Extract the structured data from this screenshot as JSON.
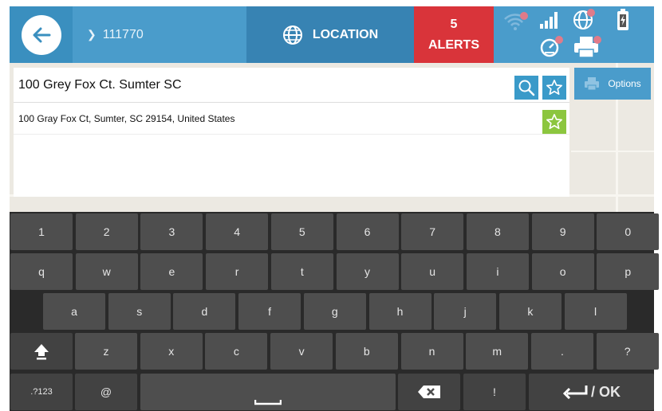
{
  "header": {
    "breadcrumb": "111770",
    "location_label": "LOCATION",
    "alerts_count": "5",
    "alerts_label": "ALERTS"
  },
  "icons": {
    "back": "arrow-left-icon",
    "globe": "globe-icon",
    "wifi": "wifi-icon",
    "signal": "signal-icon",
    "gps": "gps-icon",
    "battery": "battery-icon",
    "printer": "printer-icon",
    "search": "search-icon",
    "star": "star-icon",
    "options": "printer-icon"
  },
  "search": {
    "query": "100 Grey Fox Ct. Sumter SC",
    "result": "100 Gray Fox Ct, Sumter, SC 29154, United States",
    "options_label": "Options"
  },
  "keyboard": {
    "row1": [
      "1",
      "2",
      "3",
      "4",
      "5",
      "6",
      "7",
      "8",
      "9",
      "0"
    ],
    "row2": [
      "q",
      "w",
      "e",
      "r",
      "t",
      "y",
      "u",
      "i",
      "o",
      "p"
    ],
    "row3": [
      "a",
      "s",
      "d",
      "f",
      "g",
      "h",
      "j",
      "k",
      "l"
    ],
    "row4": [
      "z",
      "x",
      "c",
      "v",
      "b",
      "n",
      "m",
      ".",
      "?"
    ],
    "symbols_label": ".?123",
    "at_label": "@",
    "excl_label": "!",
    "ok_label": "/ OK"
  },
  "colors": {
    "accent_blue": "#3a8fbf",
    "alert_red": "#d9343a",
    "star_green": "#8cc63f",
    "keyboard_bg": "#2a2a2a",
    "key_bg": "#4e4e4e"
  }
}
